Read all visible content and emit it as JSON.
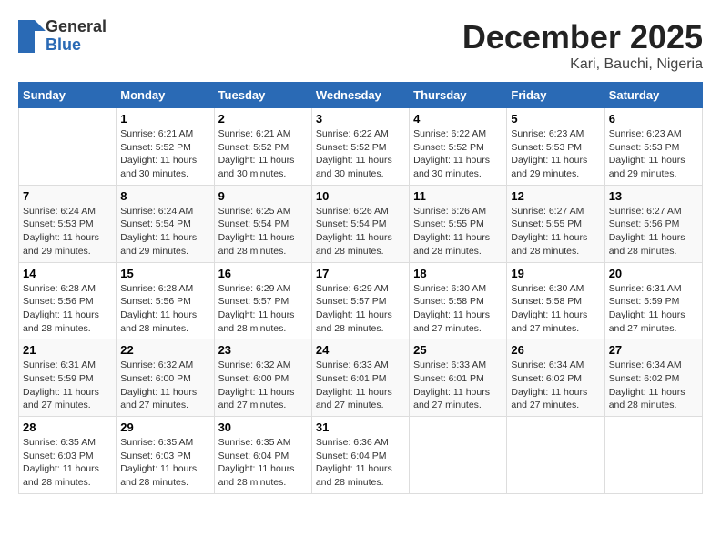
{
  "logo": {
    "general": "General",
    "blue": "Blue"
  },
  "title": "December 2025",
  "subtitle": "Kari, Bauchi, Nigeria",
  "days_of_week": [
    "Sunday",
    "Monday",
    "Tuesday",
    "Wednesday",
    "Thursday",
    "Friday",
    "Saturday"
  ],
  "weeks": [
    [
      {
        "day": "",
        "info": ""
      },
      {
        "day": "1",
        "info": "Sunrise: 6:21 AM\nSunset: 5:52 PM\nDaylight: 11 hours\nand 30 minutes."
      },
      {
        "day": "2",
        "info": "Sunrise: 6:21 AM\nSunset: 5:52 PM\nDaylight: 11 hours\nand 30 minutes."
      },
      {
        "day": "3",
        "info": "Sunrise: 6:22 AM\nSunset: 5:52 PM\nDaylight: 11 hours\nand 30 minutes."
      },
      {
        "day": "4",
        "info": "Sunrise: 6:22 AM\nSunset: 5:52 PM\nDaylight: 11 hours\nand 30 minutes."
      },
      {
        "day": "5",
        "info": "Sunrise: 6:23 AM\nSunset: 5:53 PM\nDaylight: 11 hours\nand 29 minutes."
      },
      {
        "day": "6",
        "info": "Sunrise: 6:23 AM\nSunset: 5:53 PM\nDaylight: 11 hours\nand 29 minutes."
      }
    ],
    [
      {
        "day": "7",
        "info": "Sunrise: 6:24 AM\nSunset: 5:53 PM\nDaylight: 11 hours\nand 29 minutes."
      },
      {
        "day": "8",
        "info": "Sunrise: 6:24 AM\nSunset: 5:54 PM\nDaylight: 11 hours\nand 29 minutes."
      },
      {
        "day": "9",
        "info": "Sunrise: 6:25 AM\nSunset: 5:54 PM\nDaylight: 11 hours\nand 28 minutes."
      },
      {
        "day": "10",
        "info": "Sunrise: 6:26 AM\nSunset: 5:54 PM\nDaylight: 11 hours\nand 28 minutes."
      },
      {
        "day": "11",
        "info": "Sunrise: 6:26 AM\nSunset: 5:55 PM\nDaylight: 11 hours\nand 28 minutes."
      },
      {
        "day": "12",
        "info": "Sunrise: 6:27 AM\nSunset: 5:55 PM\nDaylight: 11 hours\nand 28 minutes."
      },
      {
        "day": "13",
        "info": "Sunrise: 6:27 AM\nSunset: 5:56 PM\nDaylight: 11 hours\nand 28 minutes."
      }
    ],
    [
      {
        "day": "14",
        "info": "Sunrise: 6:28 AM\nSunset: 5:56 PM\nDaylight: 11 hours\nand 28 minutes."
      },
      {
        "day": "15",
        "info": "Sunrise: 6:28 AM\nSunset: 5:56 PM\nDaylight: 11 hours\nand 28 minutes."
      },
      {
        "day": "16",
        "info": "Sunrise: 6:29 AM\nSunset: 5:57 PM\nDaylight: 11 hours\nand 28 minutes."
      },
      {
        "day": "17",
        "info": "Sunrise: 6:29 AM\nSunset: 5:57 PM\nDaylight: 11 hours\nand 28 minutes."
      },
      {
        "day": "18",
        "info": "Sunrise: 6:30 AM\nSunset: 5:58 PM\nDaylight: 11 hours\nand 27 minutes."
      },
      {
        "day": "19",
        "info": "Sunrise: 6:30 AM\nSunset: 5:58 PM\nDaylight: 11 hours\nand 27 minutes."
      },
      {
        "day": "20",
        "info": "Sunrise: 6:31 AM\nSunset: 5:59 PM\nDaylight: 11 hours\nand 27 minutes."
      }
    ],
    [
      {
        "day": "21",
        "info": "Sunrise: 6:31 AM\nSunset: 5:59 PM\nDaylight: 11 hours\nand 27 minutes."
      },
      {
        "day": "22",
        "info": "Sunrise: 6:32 AM\nSunset: 6:00 PM\nDaylight: 11 hours\nand 27 minutes."
      },
      {
        "day": "23",
        "info": "Sunrise: 6:32 AM\nSunset: 6:00 PM\nDaylight: 11 hours\nand 27 minutes."
      },
      {
        "day": "24",
        "info": "Sunrise: 6:33 AM\nSunset: 6:01 PM\nDaylight: 11 hours\nand 27 minutes."
      },
      {
        "day": "25",
        "info": "Sunrise: 6:33 AM\nSunset: 6:01 PM\nDaylight: 11 hours\nand 27 minutes."
      },
      {
        "day": "26",
        "info": "Sunrise: 6:34 AM\nSunset: 6:02 PM\nDaylight: 11 hours\nand 27 minutes."
      },
      {
        "day": "27",
        "info": "Sunrise: 6:34 AM\nSunset: 6:02 PM\nDaylight: 11 hours\nand 28 minutes."
      }
    ],
    [
      {
        "day": "28",
        "info": "Sunrise: 6:35 AM\nSunset: 6:03 PM\nDaylight: 11 hours\nand 28 minutes."
      },
      {
        "day": "29",
        "info": "Sunrise: 6:35 AM\nSunset: 6:03 PM\nDaylight: 11 hours\nand 28 minutes."
      },
      {
        "day": "30",
        "info": "Sunrise: 6:35 AM\nSunset: 6:04 PM\nDaylight: 11 hours\nand 28 minutes."
      },
      {
        "day": "31",
        "info": "Sunrise: 6:36 AM\nSunset: 6:04 PM\nDaylight: 11 hours\nand 28 minutes."
      },
      {
        "day": "",
        "info": ""
      },
      {
        "day": "",
        "info": ""
      },
      {
        "day": "",
        "info": ""
      }
    ]
  ]
}
